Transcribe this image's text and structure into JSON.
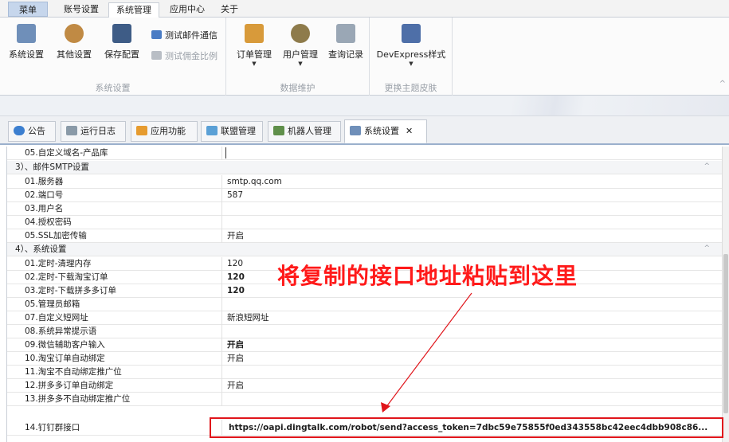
{
  "ribbon_tabs": [
    "菜单",
    "账号设置",
    "系统管理",
    "应用中心",
    "关于"
  ],
  "ribbon": {
    "groups": [
      {
        "label": "系统设置",
        "buttons": [
          "系统设置",
          "其他设置",
          "保存配置"
        ],
        "small": [
          "测试邮件通信",
          "测试佣金比例"
        ]
      },
      {
        "label": "数据维护",
        "buttons": [
          "订单管理",
          "用户管理",
          "查询记录"
        ]
      },
      {
        "label": "更换主题皮肤",
        "buttons": [
          "DevExpress样式"
        ]
      }
    ],
    "colors": {
      "settings": "#6f8fb9",
      "other": "#c08a44",
      "save": "#3e5c86",
      "mail": "#4a7cc4",
      "commission": "#9aa0a8",
      "order": "#d89a3a",
      "user": "#8e7b4b",
      "query": "#9aa7b5",
      "devexpress": "#4e6fa8"
    }
  },
  "doc_tabs": [
    {
      "label": "公告",
      "icon": "speaker-icon"
    },
    {
      "label": "运行日志",
      "icon": "log-icon"
    },
    {
      "label": "应用功能",
      "icon": "app-icon"
    },
    {
      "label": "联盟管理",
      "icon": "chart-icon"
    },
    {
      "label": "机器人管理",
      "icon": "robot-icon"
    },
    {
      "label": "系统设置",
      "icon": "settings-icon",
      "close": "✕"
    }
  ],
  "grid": {
    "partial_row": "05.自定义域名-产品库",
    "categories": {
      "smtp": "3）、邮件SMTP设置",
      "system": "4）、系统设置"
    },
    "smtp_rows": [
      {
        "name": "01.服务器",
        "value": "smtp.qq.com"
      },
      {
        "name": "02.端口号",
        "value": "587"
      },
      {
        "name": "03.用户名",
        "value": ""
      },
      {
        "name": "04.授权密码",
        "value": ""
      },
      {
        "name": "05.SSL加密传输",
        "value": "开启"
      }
    ],
    "system_rows": [
      {
        "name": "01.定时-清理内存",
        "value": "120"
      },
      {
        "name": "02.定时-下载淘宝订单",
        "value": "120"
      },
      {
        "name": "03.定时-下载拼多多订单",
        "value": "120"
      },
      {
        "name": "05.管理员邮箱",
        "value": ""
      },
      {
        "name": "07.自定义短网址",
        "value": "新浪短网址"
      },
      {
        "name": "08.系统异常提示语",
        "value": ""
      },
      {
        "name": "09.微信辅助客户输入",
        "value": "开启"
      },
      {
        "name": "10.淘宝订单自动绑定",
        "value": "开启"
      },
      {
        "name": "11.淘宝不自动绑定推广位",
        "value": ""
      },
      {
        "name": "12.拼多多订单自动绑定",
        "value": "开启"
      },
      {
        "name": "13.拼多多不自动绑定推广位",
        "value": ""
      },
      {
        "name": "14.钉钉群接口",
        "value": "https://oapi.dingtalk.com/robot/send?access_token=7dbc59e75855f0ed343558bc42eec4dbb908c86..."
      }
    ]
  },
  "annotation": {
    "text": "将复制的接口地址粘贴到这里",
    "color": "#ff1a1a"
  }
}
